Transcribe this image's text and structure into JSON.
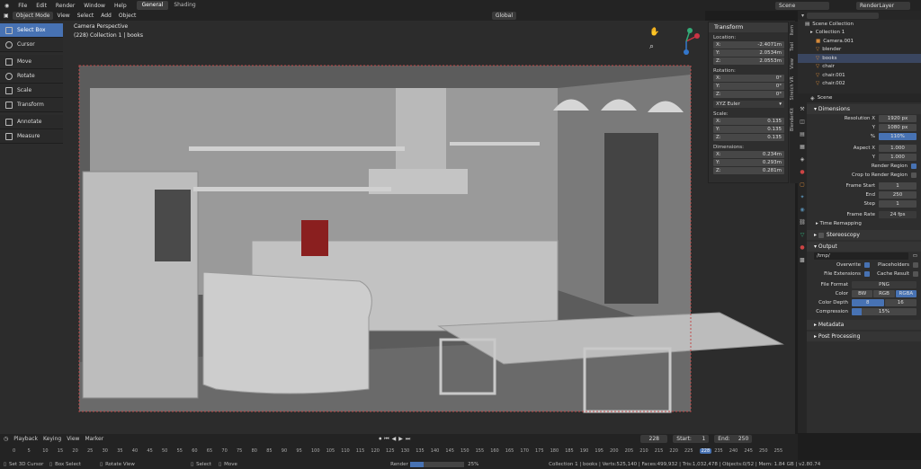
{
  "topbar": {
    "menus": [
      "File",
      "Edit",
      "Render",
      "Window",
      "Help"
    ],
    "workspaces": [
      "General",
      "Shading"
    ],
    "scene": "Scene",
    "view_layer": "RenderLayer"
  },
  "header": {
    "mode": "Object Mode",
    "menus": [
      "View",
      "Select",
      "Add",
      "Object"
    ],
    "transform_orientation": "Global"
  },
  "viewport": {
    "title": "Camera Perspective",
    "subtitle": "(228) Collection 1 | books"
  },
  "toolbar": {
    "tools": [
      {
        "label": "Select Box",
        "active": true
      },
      {
        "label": "Cursor"
      },
      {
        "label": "Move"
      },
      {
        "label": "Rotate"
      },
      {
        "label": "Scale"
      },
      {
        "label": "Transform"
      },
      {
        "label": "Annotate"
      },
      {
        "label": "Measure"
      }
    ]
  },
  "npanel": {
    "header": "Transform",
    "location_label": "Location:",
    "location": [
      [
        "X:",
        "-2.4071m"
      ],
      [
        "Y:",
        "2.0534m"
      ],
      [
        "Z:",
        "2.0553m"
      ]
    ],
    "rotation_label": "Rotation:",
    "rotation": [
      [
        "X:",
        "0°"
      ],
      [
        "Y:",
        "0°"
      ],
      [
        "Z:",
        "0°"
      ]
    ],
    "rotation_mode": "XYZ Euler",
    "scale_label": "Scale:",
    "scale": [
      [
        "X:",
        "0.135"
      ],
      [
        "Y:",
        "0.135"
      ],
      [
        "Z:",
        "0.135"
      ]
    ],
    "dimensions_label": "Dimensions:",
    "dimensions": [
      [
        "X:",
        "0.234m"
      ],
      [
        "Y:",
        "0.293m"
      ],
      [
        "Z:",
        "0.281m"
      ]
    ],
    "tabs": [
      "Item",
      "Tool",
      "View",
      "Stretch VR",
      "BlenderKit"
    ]
  },
  "outliner": {
    "title": "Scene Collection",
    "items": [
      "Collection 1",
      "Camera.001",
      "blender",
      "books",
      "chair",
      "chair.001",
      "chair.002"
    ]
  },
  "properties": {
    "scene": "Scene",
    "dimensions_title": "Dimensions",
    "rows": [
      [
        "Resolution X",
        "1920 px"
      ],
      [
        "Y",
        "1080 px"
      ],
      [
        "%",
        "110%"
      ],
      [
        "Aspect X",
        "1.000"
      ],
      [
        "Y",
        "1.000"
      ]
    ],
    "render_region": "Render Region",
    "crop": "Crop to Render Region",
    "frames": [
      [
        "Frame Start",
        "1"
      ],
      [
        "End",
        "250"
      ],
      [
        "Step",
        "1"
      ]
    ],
    "frame_rate_label": "Frame Rate",
    "frame_rate": "24 fps",
    "time_remapping": "Time Remapping",
    "stereoscopy": "Stereoscopy",
    "output_title": "Output",
    "output_path": "/tmp/",
    "overwrite": "Overwrite",
    "placeholders": "Placeholders",
    "file_extensions": "File Extensions",
    "cache_result": "Cache Result",
    "file_format_label": "File Format",
    "file_format": "PNG",
    "color_label": "Color",
    "color_opts": [
      "BW",
      "RGB",
      "RGBA"
    ],
    "color_depth_label": "Color Depth",
    "color_depth": [
      "8",
      "16"
    ],
    "compression_label": "Compression",
    "compression": "15%",
    "metadata": "Metadata",
    "post_processing": "Post Processing"
  },
  "timeline": {
    "menus": [
      "Playback",
      "Keying",
      "View",
      "Marker"
    ],
    "current_frame": "228",
    "start_label": "Start:",
    "start": "1",
    "end_label": "End:",
    "end": "250",
    "ticks": [
      "0",
      "5",
      "10",
      "15",
      "20",
      "25",
      "30",
      "35",
      "40",
      "45",
      "50",
      "55",
      "60",
      "65",
      "70",
      "75",
      "80",
      "85",
      "90",
      "95",
      "100",
      "105",
      "110",
      "115",
      "120",
      "125",
      "130",
      "135",
      "140",
      "145",
      "150",
      "155",
      "160",
      "165",
      "170",
      "175",
      "180",
      "185",
      "190",
      "195",
      "200",
      "205",
      "210",
      "215",
      "220",
      "225",
      "228",
      "235",
      "240",
      "245",
      "250",
      "255"
    ]
  },
  "statusbar": {
    "items": [
      "Set 3D Cursor",
      "Box Select",
      "Rotate View",
      "Select",
      "Move"
    ],
    "render_label": "Render",
    "render_progress": "25%",
    "stats": "Collection 1 | books | Verts:525,140 | Faces:499,932 | Tris:1,032,478 | Objects:0/52 | Mem: 1.84 GB | v2.80.74"
  }
}
